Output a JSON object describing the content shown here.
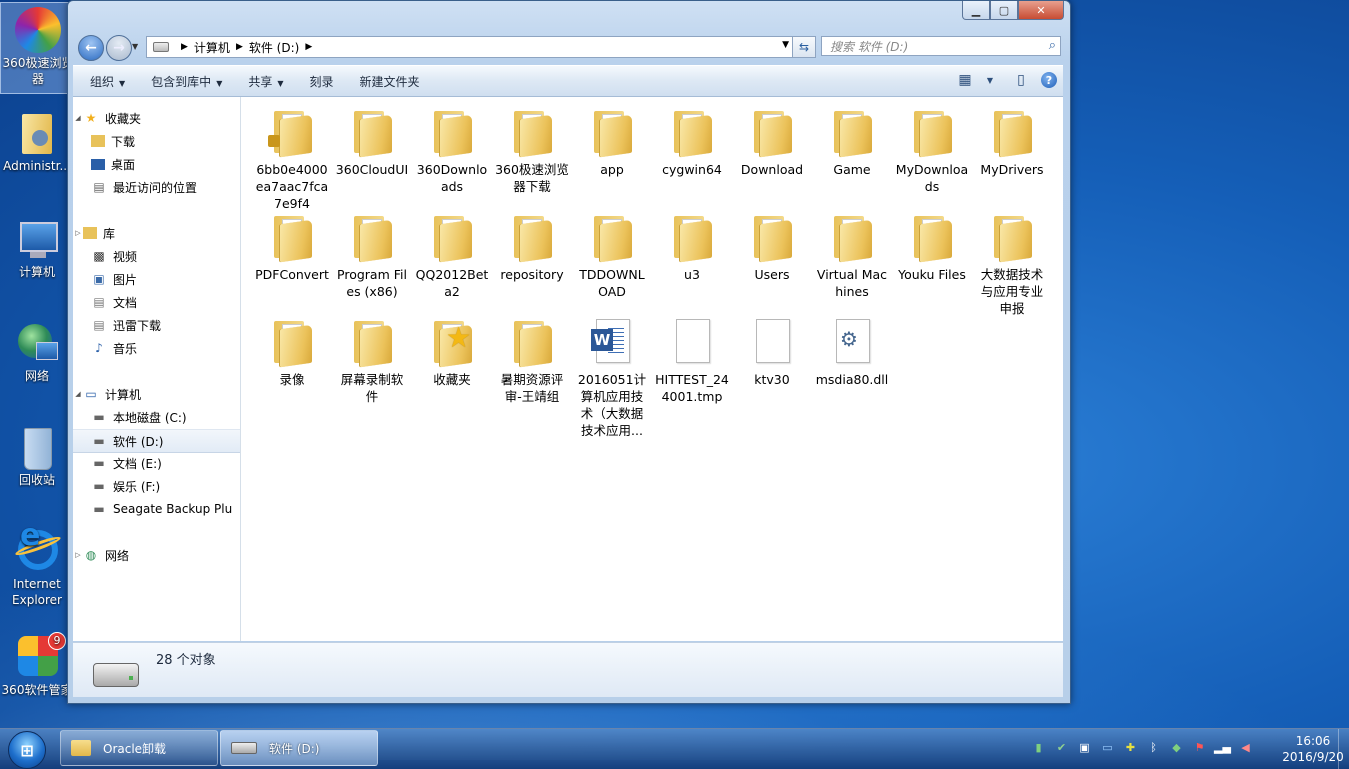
{
  "desktop": {
    "icons": [
      {
        "label": "360极速浏览器"
      },
      {
        "label": "Administr..."
      },
      {
        "label": "计算机"
      },
      {
        "label": "网络"
      },
      {
        "label": "回收站"
      },
      {
        "label": "Internet Explorer"
      },
      {
        "label": "360软件管家",
        "badge": "9"
      }
    ]
  },
  "window": {
    "controls": {
      "minimize": "▁",
      "maximize": "▢",
      "close": "✕"
    },
    "address": {
      "segments": [
        "计算机",
        "软件 (D:)"
      ]
    },
    "search": {
      "placeholder": "搜索 软件 (D:)"
    },
    "toolbar": {
      "organize": "组织",
      "include_library": "包含到库中",
      "share": "共享",
      "burn": "刻录",
      "new_folder": "新建文件夹"
    },
    "nav_pane": {
      "favorites": "收藏夹",
      "favorites_items": [
        "下载",
        "桌面",
        "最近访问的位置"
      ],
      "libraries": "库",
      "library_items": [
        "视频",
        "图片",
        "文档",
        "迅雷下载",
        "音乐"
      ],
      "computer": "计算机",
      "computer_items": [
        "本地磁盘 (C:)",
        "软件 (D:)",
        "文档 (E:)",
        "娱乐 (F:)",
        "Seagate Backup Plu"
      ],
      "network": "网络"
    },
    "files": [
      {
        "name": "6bb0e4000ea7aac7fca7e9f4",
        "type": "folder-locked"
      },
      {
        "name": "360CloudUI",
        "type": "folder"
      },
      {
        "name": "360Downloads",
        "type": "folder"
      },
      {
        "name": "360极速浏览器下载",
        "type": "folder"
      },
      {
        "name": "app",
        "type": "folder"
      },
      {
        "name": "cygwin64",
        "type": "folder"
      },
      {
        "name": "Download",
        "type": "folder"
      },
      {
        "name": "Game",
        "type": "folder"
      },
      {
        "name": "MyDownloads",
        "type": "folder"
      },
      {
        "name": "MyDrivers",
        "type": "folder"
      },
      {
        "name": "PDFConvert",
        "type": "folder"
      },
      {
        "name": "Program Files (x86)",
        "type": "folder"
      },
      {
        "name": "QQ2012Beta2",
        "type": "folder"
      },
      {
        "name": "repository",
        "type": "folder"
      },
      {
        "name": "TDDOWNLOAD",
        "type": "folder"
      },
      {
        "name": "u3",
        "type": "folder"
      },
      {
        "name": "Users",
        "type": "folder"
      },
      {
        "name": "Virtual Machines",
        "type": "folder"
      },
      {
        "name": "Youku Files",
        "type": "folder"
      },
      {
        "name": "大数据技术与应用专业申报",
        "type": "folder"
      },
      {
        "name": "录像",
        "type": "folder"
      },
      {
        "name": "屏幕录制软件",
        "type": "folder"
      },
      {
        "name": "收藏夹",
        "type": "folder-favorites"
      },
      {
        "name": "暑期资源评审-王靖组",
        "type": "folder"
      },
      {
        "name": "2016051计算机应用技术（大数据技术应用...",
        "type": "word-doc"
      },
      {
        "name": "HITTEST_244001.tmp",
        "type": "file"
      },
      {
        "name": "ktv30",
        "type": "file"
      },
      {
        "name": "msdia80.dll",
        "type": "dll"
      }
    ],
    "status": {
      "count": "28 个对象"
    }
  },
  "taskbar": {
    "buttons": [
      {
        "label": "Oracle卸载"
      },
      {
        "label": "软件 (D:)"
      }
    ],
    "clock": {
      "time": "16:06",
      "date": "2016/9/20"
    }
  }
}
